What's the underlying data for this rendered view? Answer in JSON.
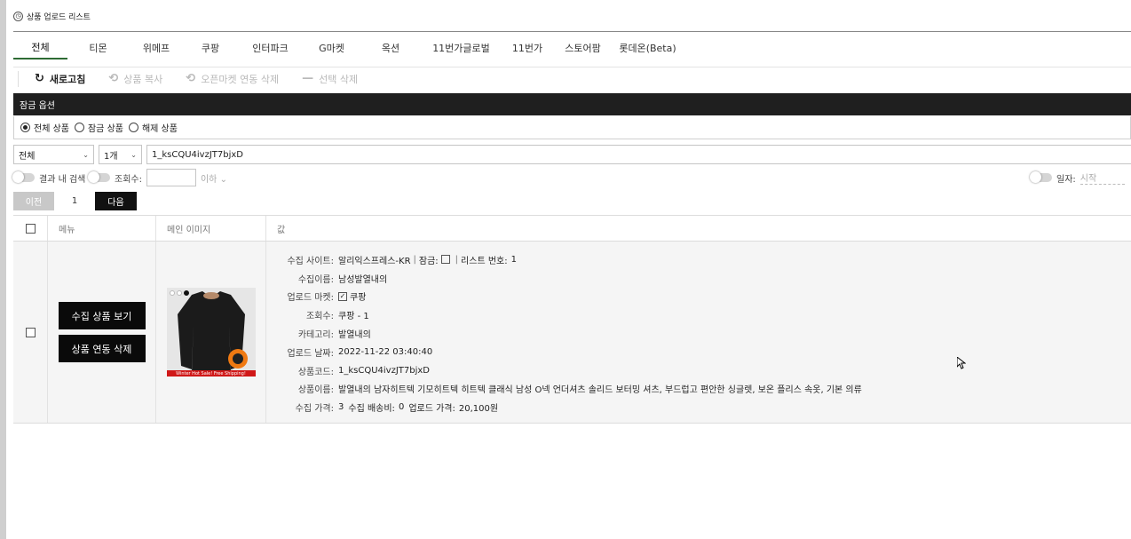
{
  "window": {
    "title": "상품 업로드 리스트"
  },
  "tabs": [
    "전체",
    "티몬",
    "위메프",
    "쿠팡",
    "인터파크",
    "G마켓",
    "옥션",
    "11번가글로벌",
    "11번가",
    "스토어팜",
    "롯데온(Beta)"
  ],
  "active_tab": "전체",
  "toolbar": {
    "refresh": "새로고침",
    "copy": "상품 복사",
    "openmarket_delete": "오픈마켓 연동 삭제",
    "selected_delete": "선택 삭제"
  },
  "lock_section": {
    "title": "잠금 옵션",
    "options": [
      "전체 상품",
      "잠금 상품",
      "해제 상품"
    ],
    "selected": "전체 상품"
  },
  "filters": {
    "category_select": "전체",
    "count_select": "1개",
    "search_value": "1_ksCQU4ivzJT7bjxD"
  },
  "options": {
    "in_results": "결과 내 검색",
    "views_label": "조회수:",
    "views_below": "이하",
    "date_label": "일자:",
    "date_start": "시작"
  },
  "pager": {
    "prev": "이전",
    "page": "1",
    "next": "다음"
  },
  "table": {
    "headers": {
      "menu": "메뉴",
      "main_image": "메인 이미지",
      "value": "값"
    },
    "row": {
      "view_button": "수집 상품 보기",
      "delete_button": "상품 연동 삭제",
      "image_banner": "Winter Hot Sale! Free Shipping!",
      "fields": {
        "site_label": "수집 사이트:",
        "site_value": "알리익스프레스-KR",
        "lock_label": "잠금:",
        "list_no_label": "리스트 번호:",
        "list_no": "1",
        "collect_name_label": "수집이름:",
        "collect_name": "남성발열내의",
        "upload_market_label": "업로드 마켓:",
        "upload_market": "쿠팡",
        "views_label": "조회수:",
        "views_value": "쿠팡 - 1",
        "category_label": "카테고리:",
        "category": "발열내의",
        "upload_date_label": "업로드 날짜:",
        "upload_date": "2022-11-22 03:40:40",
        "product_code_label": "상품코드:",
        "product_code": "1_ksCQU4ivzJT7bjxD",
        "product_name_label": "상품이름:",
        "product_name": "발열내의 남자히트텍 기모히트텍 히트텍 클래식 남성 O넥 언더셔츠 솔리드 보터밍 셔츠, 부드럽고 편안한 싱글렛, 보온 플리스 속옷, 기본 의류",
        "price_label": "수집 가격:",
        "price": "3",
        "shipping_label": "수집 배송비:",
        "shipping": "0",
        "upload_price_label": "업로드 가격:",
        "upload_price": "20,100원"
      }
    }
  }
}
